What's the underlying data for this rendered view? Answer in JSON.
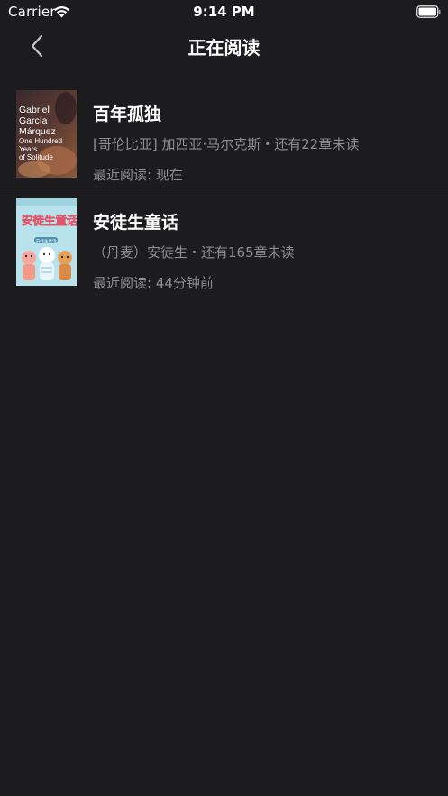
{
  "status_bar": {
    "carrier": "Carrier",
    "time": "9:14 PM",
    "wifi_icon": "wifi-icon",
    "battery_icon": "battery-icon"
  },
  "nav": {
    "title": "正在阅读",
    "back_icon": "chevron-left-icon"
  },
  "books": [
    {
      "title": "百年孤独",
      "meta": "[哥伦比亚] 加西亚·马尔克斯・还有22章未读",
      "last_read": "最近阅读: 现在",
      "cover_text": [
        "Gabriel",
        "García",
        "Márquez",
        "One Hundred",
        "Years",
        "of Solitude"
      ]
    },
    {
      "title": "安徒生童话",
      "meta": "（丹麦）安徒生・还有165章未读",
      "last_read": "最近阅读: 44分钟前",
      "cover_text": [
        "安徒生童话",
        "安徒生童话"
      ]
    }
  ],
  "colors": {
    "background": "#1c1c1e",
    "primary_text": "#ffffff",
    "secondary_text": "#8e8e93",
    "divider": "#4a4a4d",
    "cover1_bg": "#4a2a2a",
    "cover2_bg": "#a9dbe6"
  }
}
